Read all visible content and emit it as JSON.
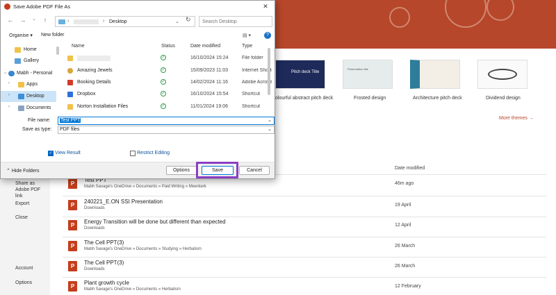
{
  "dialog": {
    "title": "Save Adobe PDF File As",
    "close": "✕",
    "address": {
      "current": "Desktop",
      "chevron": "›",
      "chevron_end": "⌄",
      "refresh": "↻"
    },
    "search": {
      "placeholder": "Search Desktop"
    },
    "toolbar": {
      "organise": "Organise ▾",
      "new_folder": "New folder",
      "view": "▤ ▾",
      "help": "?"
    },
    "nav_pane": [
      {
        "label": "Home",
        "icon": "home-icon",
        "arrow": ""
      },
      {
        "label": "Gallery",
        "icon": "gallery-icon",
        "arrow": ""
      },
      {
        "label": "Mabh - Personal",
        "icon": "cloud-icon",
        "arrow": "⌄"
      },
      {
        "label": "Apps",
        "icon": "folder-icon",
        "arrow": "›"
      },
      {
        "label": "Desktop",
        "icon": "desktop-icon",
        "arrow": "›"
      },
      {
        "label": "Documents",
        "icon": "documents-icon",
        "arrow": "›"
      }
    ],
    "columns": {
      "name": "Name",
      "status": "Status",
      "date": "Date modified",
      "type": "Type"
    },
    "files": [
      {
        "name": "",
        "status": "✓",
        "date": "16/10/2024 15:24",
        "type": "File folder"
      },
      {
        "name": "Amazing Jewels",
        "status": "✓",
        "date": "15/09/2023 11:03",
        "type": "Internet Shortcut"
      },
      {
        "name": "Booking Details",
        "status": "✓",
        "date": "14/02/2024 11:16",
        "type": "Adobe Acrobat"
      },
      {
        "name": "Dropbox",
        "status": "✓",
        "date": "16/10/2024 15:54",
        "type": "Shortcut"
      },
      {
        "name": "Norton Installation Files",
        "status": "✓",
        "date": "11/01/2024 19:06",
        "type": "Shortcut"
      }
    ],
    "file_name_label": "File name:",
    "file_name_value": "Test PPT",
    "save_as_type_label": "Save as type:",
    "save_as_type_value": "PDF files",
    "view_result": "View Result",
    "restrict_editing": "Restrict Editing",
    "hide_folders": "Hide Folders",
    "buttons": {
      "options": "Options",
      "save": "Save",
      "cancel": "Cancel"
    }
  },
  "backstage": {
    "nav": [
      "Share as Adobe PDF link",
      "Export",
      "Close",
      "Account",
      "Options"
    ],
    "themes": [
      {
        "label": "olourful abstract pitch deck",
        "thumb_title": "Pitch deck Title"
      },
      {
        "label": "Frosted design",
        "thumb_title": "Presentation title"
      },
      {
        "label": "Architecture pitch deck",
        "thumb_title": ""
      },
      {
        "label": "Dividend design",
        "thumb_title": ""
      }
    ],
    "more_themes": "More themes →",
    "date_modified_header": "Date modified",
    "recent_files": [
      {
        "name": "Test PPT",
        "path": "Mabh Savage's OneDrive » Documents » Paid Writing » Meerkerk",
        "date": "46m ago"
      },
      {
        "name": "240221_E.ON SSI Presentation",
        "path": "Downloads",
        "date": "19 April"
      },
      {
        "name": "Energy Transition will be done but different than expected",
        "path": "Downloads",
        "date": "12 April"
      },
      {
        "name": "The Cell PPT(3)",
        "path": "Mabh Savage's OneDrive » Documents » Studying » Herbalism",
        "date": "26 March"
      },
      {
        "name": "The Cell PPT(3)",
        "path": "Downloads",
        "date": "26 March"
      },
      {
        "name": "Plant growth cycle",
        "path": "Mabh Savage's OneDrive » Documents » Herbalism",
        "date": "12 February"
      }
    ]
  },
  "colors": {
    "accent_orange": "#b7472a",
    "highlight_purple": "#8a3fc4",
    "selection_blue": "#0078d7"
  }
}
